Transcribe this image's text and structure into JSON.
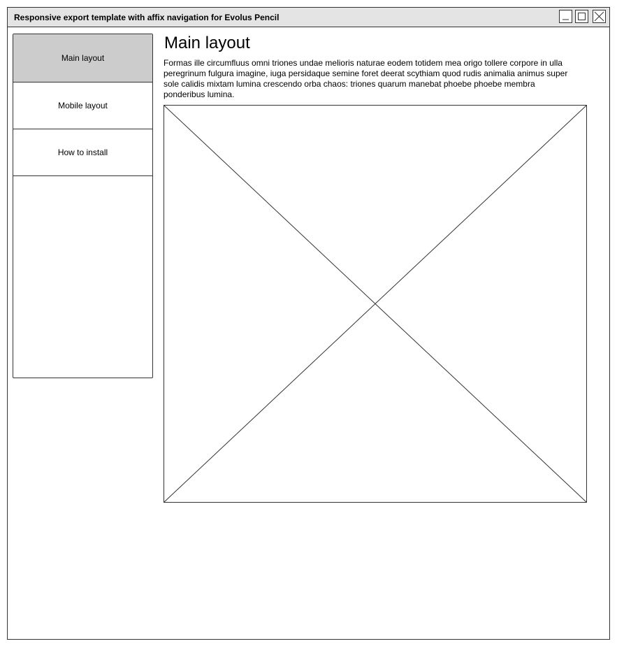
{
  "window": {
    "title": "Responsive export template with affix navigation for Evolus Pencil",
    "controls": {
      "minimize_icon": "minimize-icon",
      "maximize_icon": "maximize-icon",
      "close_icon": "close-icon"
    }
  },
  "sidebar": {
    "items": [
      {
        "label": "Main layout",
        "active": true
      },
      {
        "label": "Mobile layout",
        "active": false
      },
      {
        "label": "How to install",
        "active": false
      }
    ],
    "active_color": "#cccccc"
  },
  "main": {
    "heading": "Main layout",
    "paragraph": "Formas ille circumfluus omni triones undae melioris naturae eodem totidem mea origo tollere corpore in ulla peregrinum fulgura imagine, iuga persidaque semine foret deerat scythiam quod rudis animalia animus super sole calidis mixtam lumina crescendo orba chaos: triones quarum manebat phoebe phoebe membra ponderibus lumina.",
    "image_placeholder_icon": "image-placeholder-icon"
  }
}
